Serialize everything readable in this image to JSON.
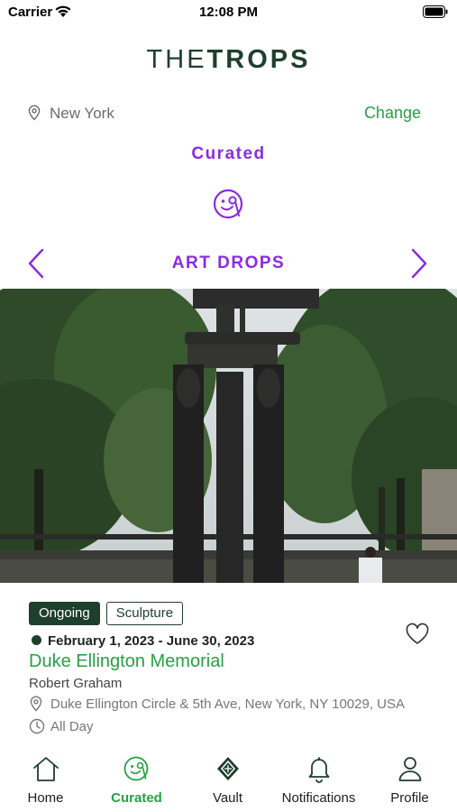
{
  "status_bar": {
    "carrier": "Carrier",
    "time": "12:08 PM"
  },
  "app": {
    "logo_part1": "THE",
    "logo_part2": "TROPS",
    "brand_color": "#1e3f2d",
    "accent_green": "#25a244",
    "accent_purple": "#8a2be2"
  },
  "location": {
    "city": "New York",
    "change_label": "Change"
  },
  "section": {
    "title": "Curated",
    "category": "ART DROPS"
  },
  "event": {
    "status_tag": "Ongoing",
    "category_tag": "Sculpture",
    "dates": "February 1, 2023 - June 30, 2023",
    "title": "Duke Ellington Memorial",
    "artist": "Robert Graham",
    "address": "Duke Ellington Circle & 5th Ave, New York, NY 10029, USA",
    "hours": "All Day",
    "image_subject": "bronze-sculpture-columns-park"
  },
  "tab_bar": {
    "items": [
      {
        "label": "Home",
        "icon": "home-icon",
        "active": false
      },
      {
        "label": "Curated",
        "icon": "curated-face-icon",
        "active": true
      },
      {
        "label": "Vault",
        "icon": "vault-diamond-icon",
        "active": false
      },
      {
        "label": "Notifications",
        "icon": "bell-icon",
        "active": false
      },
      {
        "label": "Profile",
        "icon": "person-icon",
        "active": false
      }
    ]
  }
}
